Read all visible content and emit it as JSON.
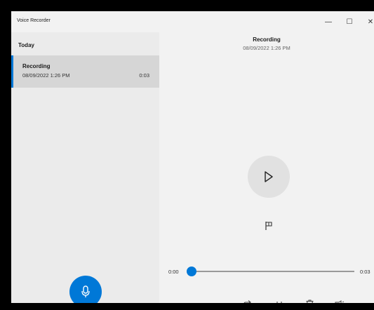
{
  "window": {
    "title": "Voice Recorder",
    "controls": {
      "minimize": "—",
      "maximize": "☐",
      "close": "✕"
    }
  },
  "sidebar": {
    "group_header": "Today",
    "recordings": [
      {
        "name": "Recording",
        "date": "08/09/2022 1:26 PM",
        "duration": "0:03",
        "selected": true
      }
    ],
    "record_button_icon": "microphone-icon"
  },
  "player": {
    "title": "Recording",
    "date": "08/09/2022 1:26 PM",
    "play_icon": "play-icon",
    "flag_icon": "flag-icon",
    "time_current": "0:00",
    "time_total": "0:03",
    "progress": 0.0
  },
  "toolbar": {
    "icons": [
      "share-icon",
      "trim-icon",
      "delete-icon",
      "rename-icon",
      "more-icon"
    ],
    "more_label": "···"
  },
  "colors": {
    "accent": "#0078d7",
    "sidebar_bg": "#ebebeb",
    "selected_bg": "#d6d6d6",
    "window_bg": "#f2f2f2"
  }
}
